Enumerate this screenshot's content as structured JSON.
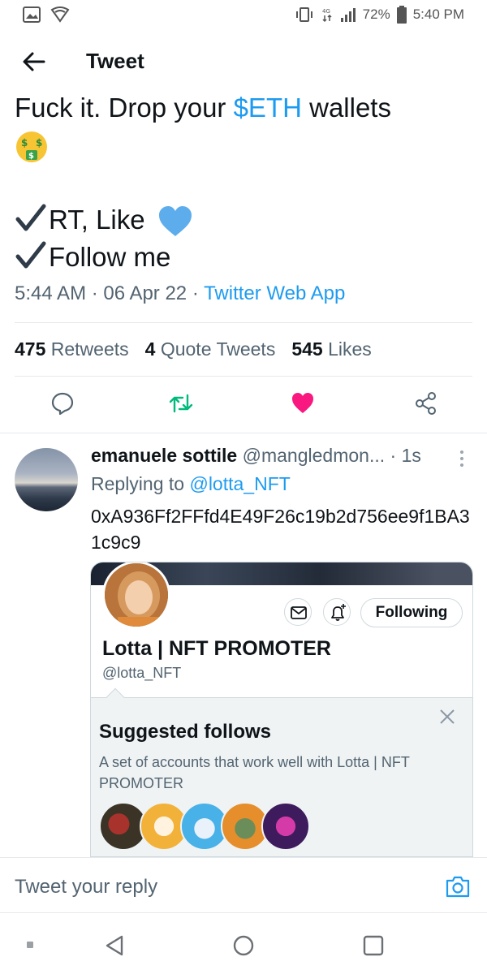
{
  "status_bar": {
    "battery": "72%",
    "time": "5:40 PM"
  },
  "header": {
    "title": "Tweet"
  },
  "tweet": {
    "line1_before": "Fuck it. Drop your ",
    "cashtag": "$ETH",
    "line1_after": " wallets",
    "line3": "RT, Like",
    "line4": "Follow me",
    "time": "5:44 AM",
    "sep": "·",
    "date": "06 Apr 22",
    "app": "Twitter Web App",
    "retweets_count": "475",
    "retweets_label": "Retweets",
    "quotes_count": "4",
    "quotes_label": "Quote Tweets",
    "likes_count": "545",
    "likes_label": "Likes"
  },
  "reply": {
    "name": "emanuele sottile",
    "handle": "@mangledmon...",
    "age": "· 1s",
    "replying_label": "Replying to ",
    "replying_to": "@lotta_NFT",
    "text": "0xA936Ff2FFfd4E49F26c19b2d756ee9f1BA31c9c9"
  },
  "card": {
    "following_label": "Following",
    "profile_name": "Lotta | NFT PROMOTER",
    "profile_handle": "@lotta_NFT",
    "suggested_title": "Suggested follows",
    "suggested_desc": "A set of accounts that work well with Lotta | NFT PROMOTER"
  },
  "reply_bar": {
    "placeholder": "Tweet your reply"
  },
  "colors": {
    "accent": "#1d9bf0",
    "like": "#f91880",
    "retweet": "#00ba7c"
  }
}
